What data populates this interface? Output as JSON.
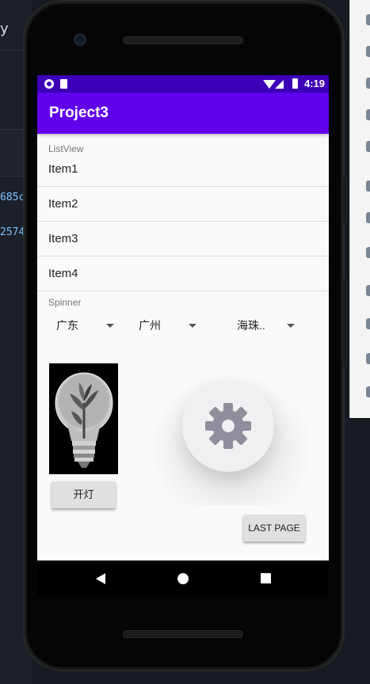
{
  "ide": {
    "fragment_top": "y",
    "fragment_line1": "685c",
    "fragment_line2": "2574"
  },
  "status_bar": {
    "time": "4:19"
  },
  "app_bar": {
    "title": "Project3"
  },
  "listview": {
    "caption": "ListView",
    "items": [
      {
        "label": "Item1"
      },
      {
        "label": "Item2"
      },
      {
        "label": "Item3"
      },
      {
        "label": "Item4"
      }
    ]
  },
  "spinner_section": {
    "caption": "Spinner",
    "spinners": [
      {
        "selected": "广东"
      },
      {
        "selected": "广州"
      },
      {
        "selected": "海珠.."
      }
    ]
  },
  "controls": {
    "light_button": "开灯",
    "last_page_button": "LAST PAGE"
  },
  "colors": {
    "status_bar": "#3d00b8",
    "app_bar": "#6200ee",
    "gear": "#8e8e9c"
  },
  "icons": [
    "lightbulb-image",
    "gear-icon",
    "back-icon",
    "home-icon",
    "recent-apps-icon"
  ]
}
